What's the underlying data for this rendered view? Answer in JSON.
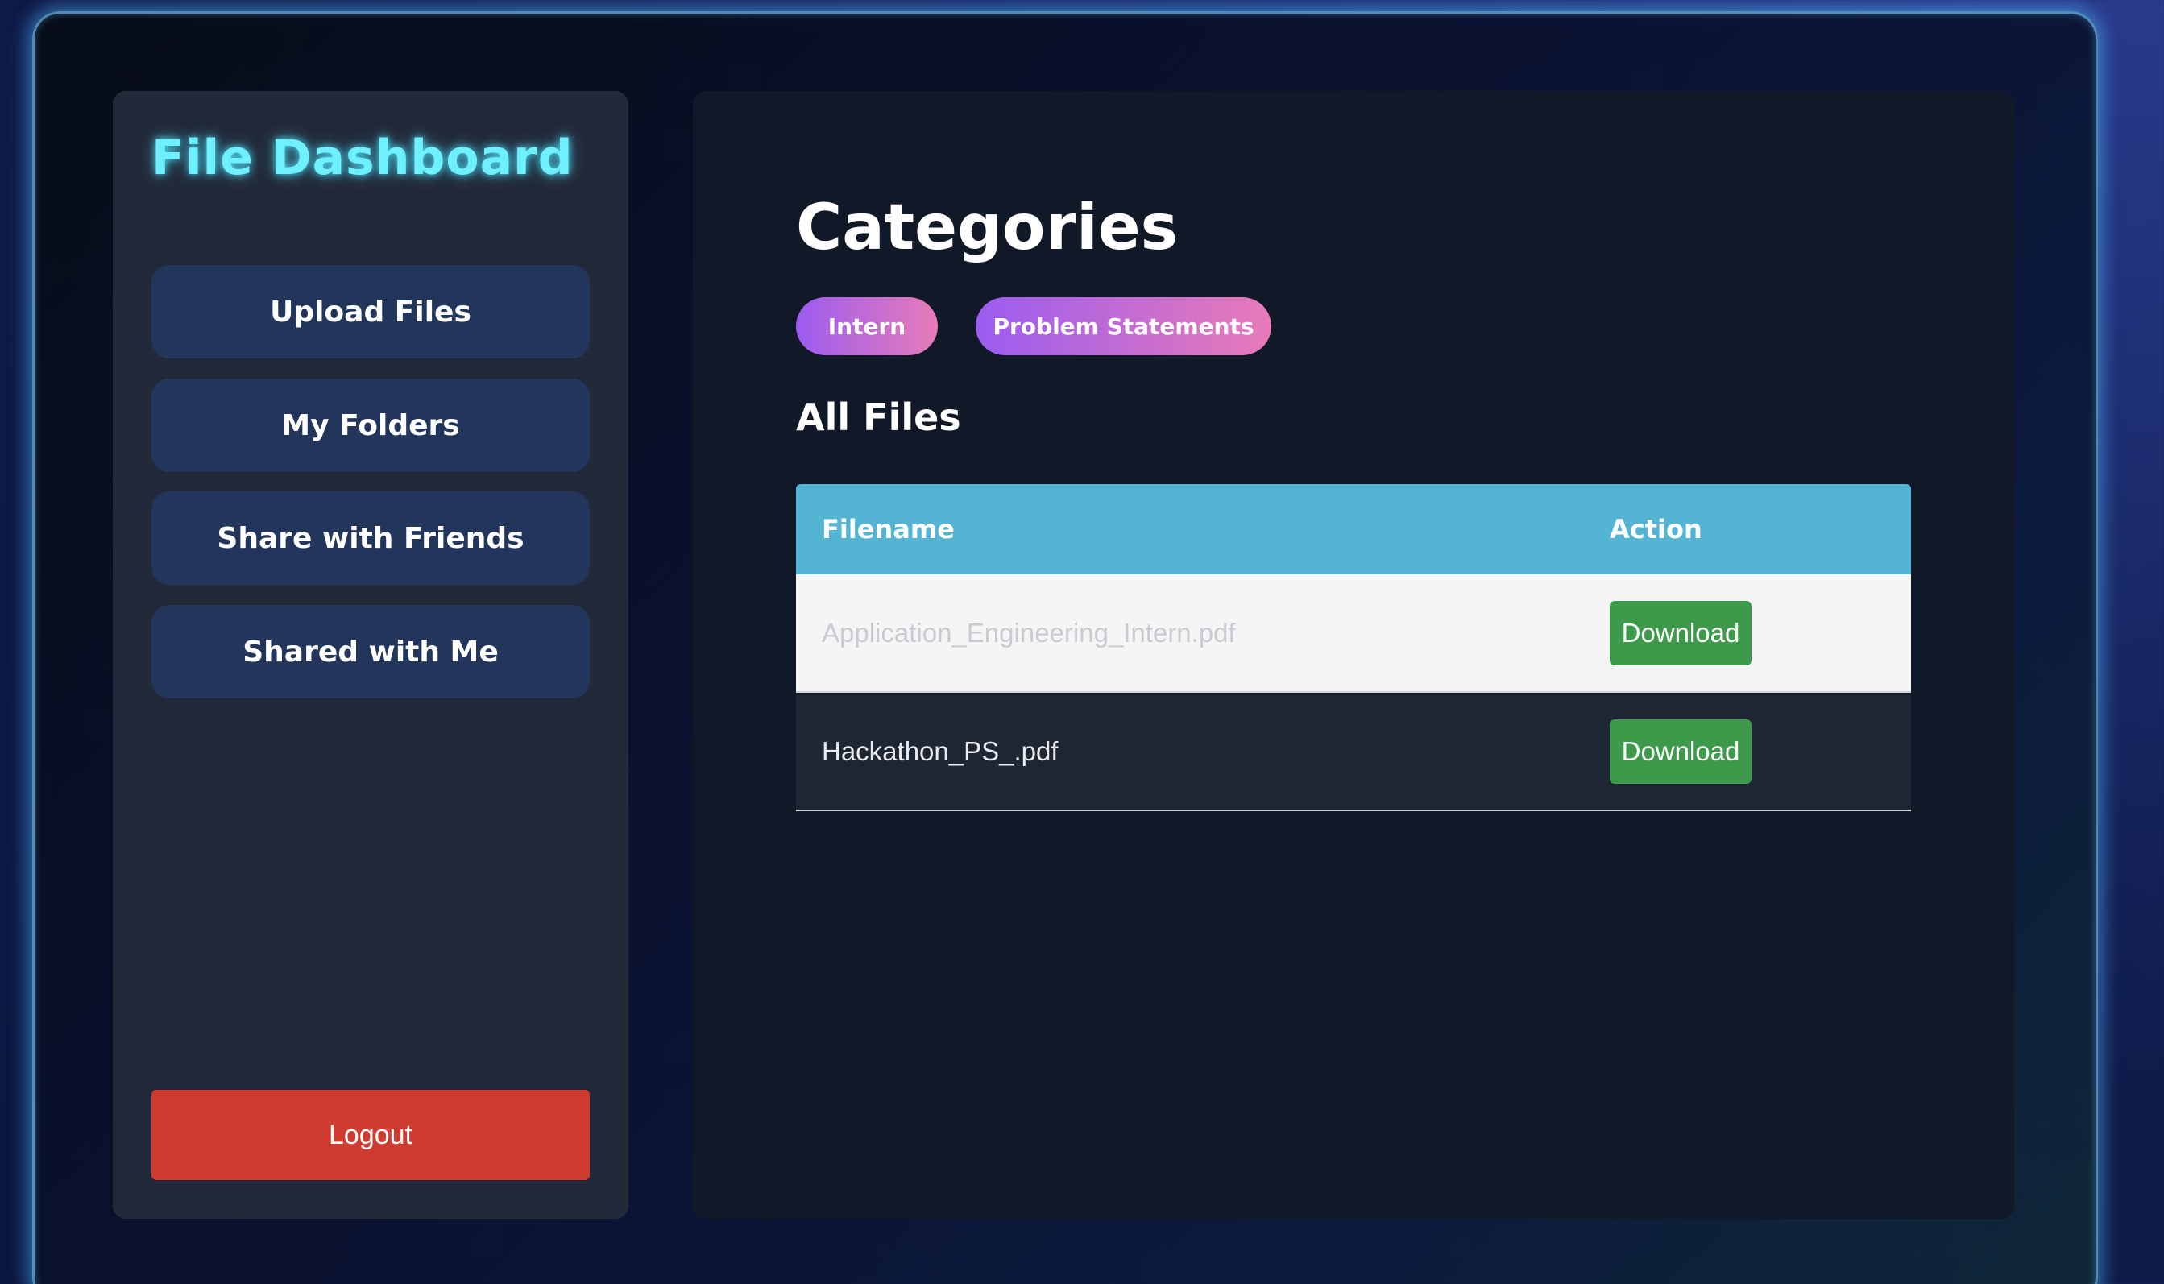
{
  "sidebar": {
    "brand": "File Dashboard",
    "nav": [
      {
        "label": "Upload Files"
      },
      {
        "label": "My Folders"
      },
      {
        "label": "Share with Friends"
      },
      {
        "label": "Shared with Me"
      }
    ],
    "logout_label": "Logout"
  },
  "main": {
    "categories_title": "Categories",
    "categories": [
      {
        "label": "Intern"
      },
      {
        "label": "Problem Statements"
      }
    ],
    "files_title": "All Files",
    "table": {
      "headers": {
        "filename": "Filename",
        "action": "Action"
      },
      "rows": [
        {
          "filename": "Application_Engineering_Intern.pdf",
          "action": "Download"
        },
        {
          "filename": "Hackathon_PS_.pdf",
          "action": "Download"
        }
      ]
    }
  },
  "colors": {
    "brand": "#6ef0ff",
    "nav_button": "#22365c",
    "logout": "#cc3a30",
    "table_header": "#53b4d4",
    "download": "#3d9a4a",
    "pill_start": "#9b5cf0",
    "pill_end": "#e87bb8"
  }
}
